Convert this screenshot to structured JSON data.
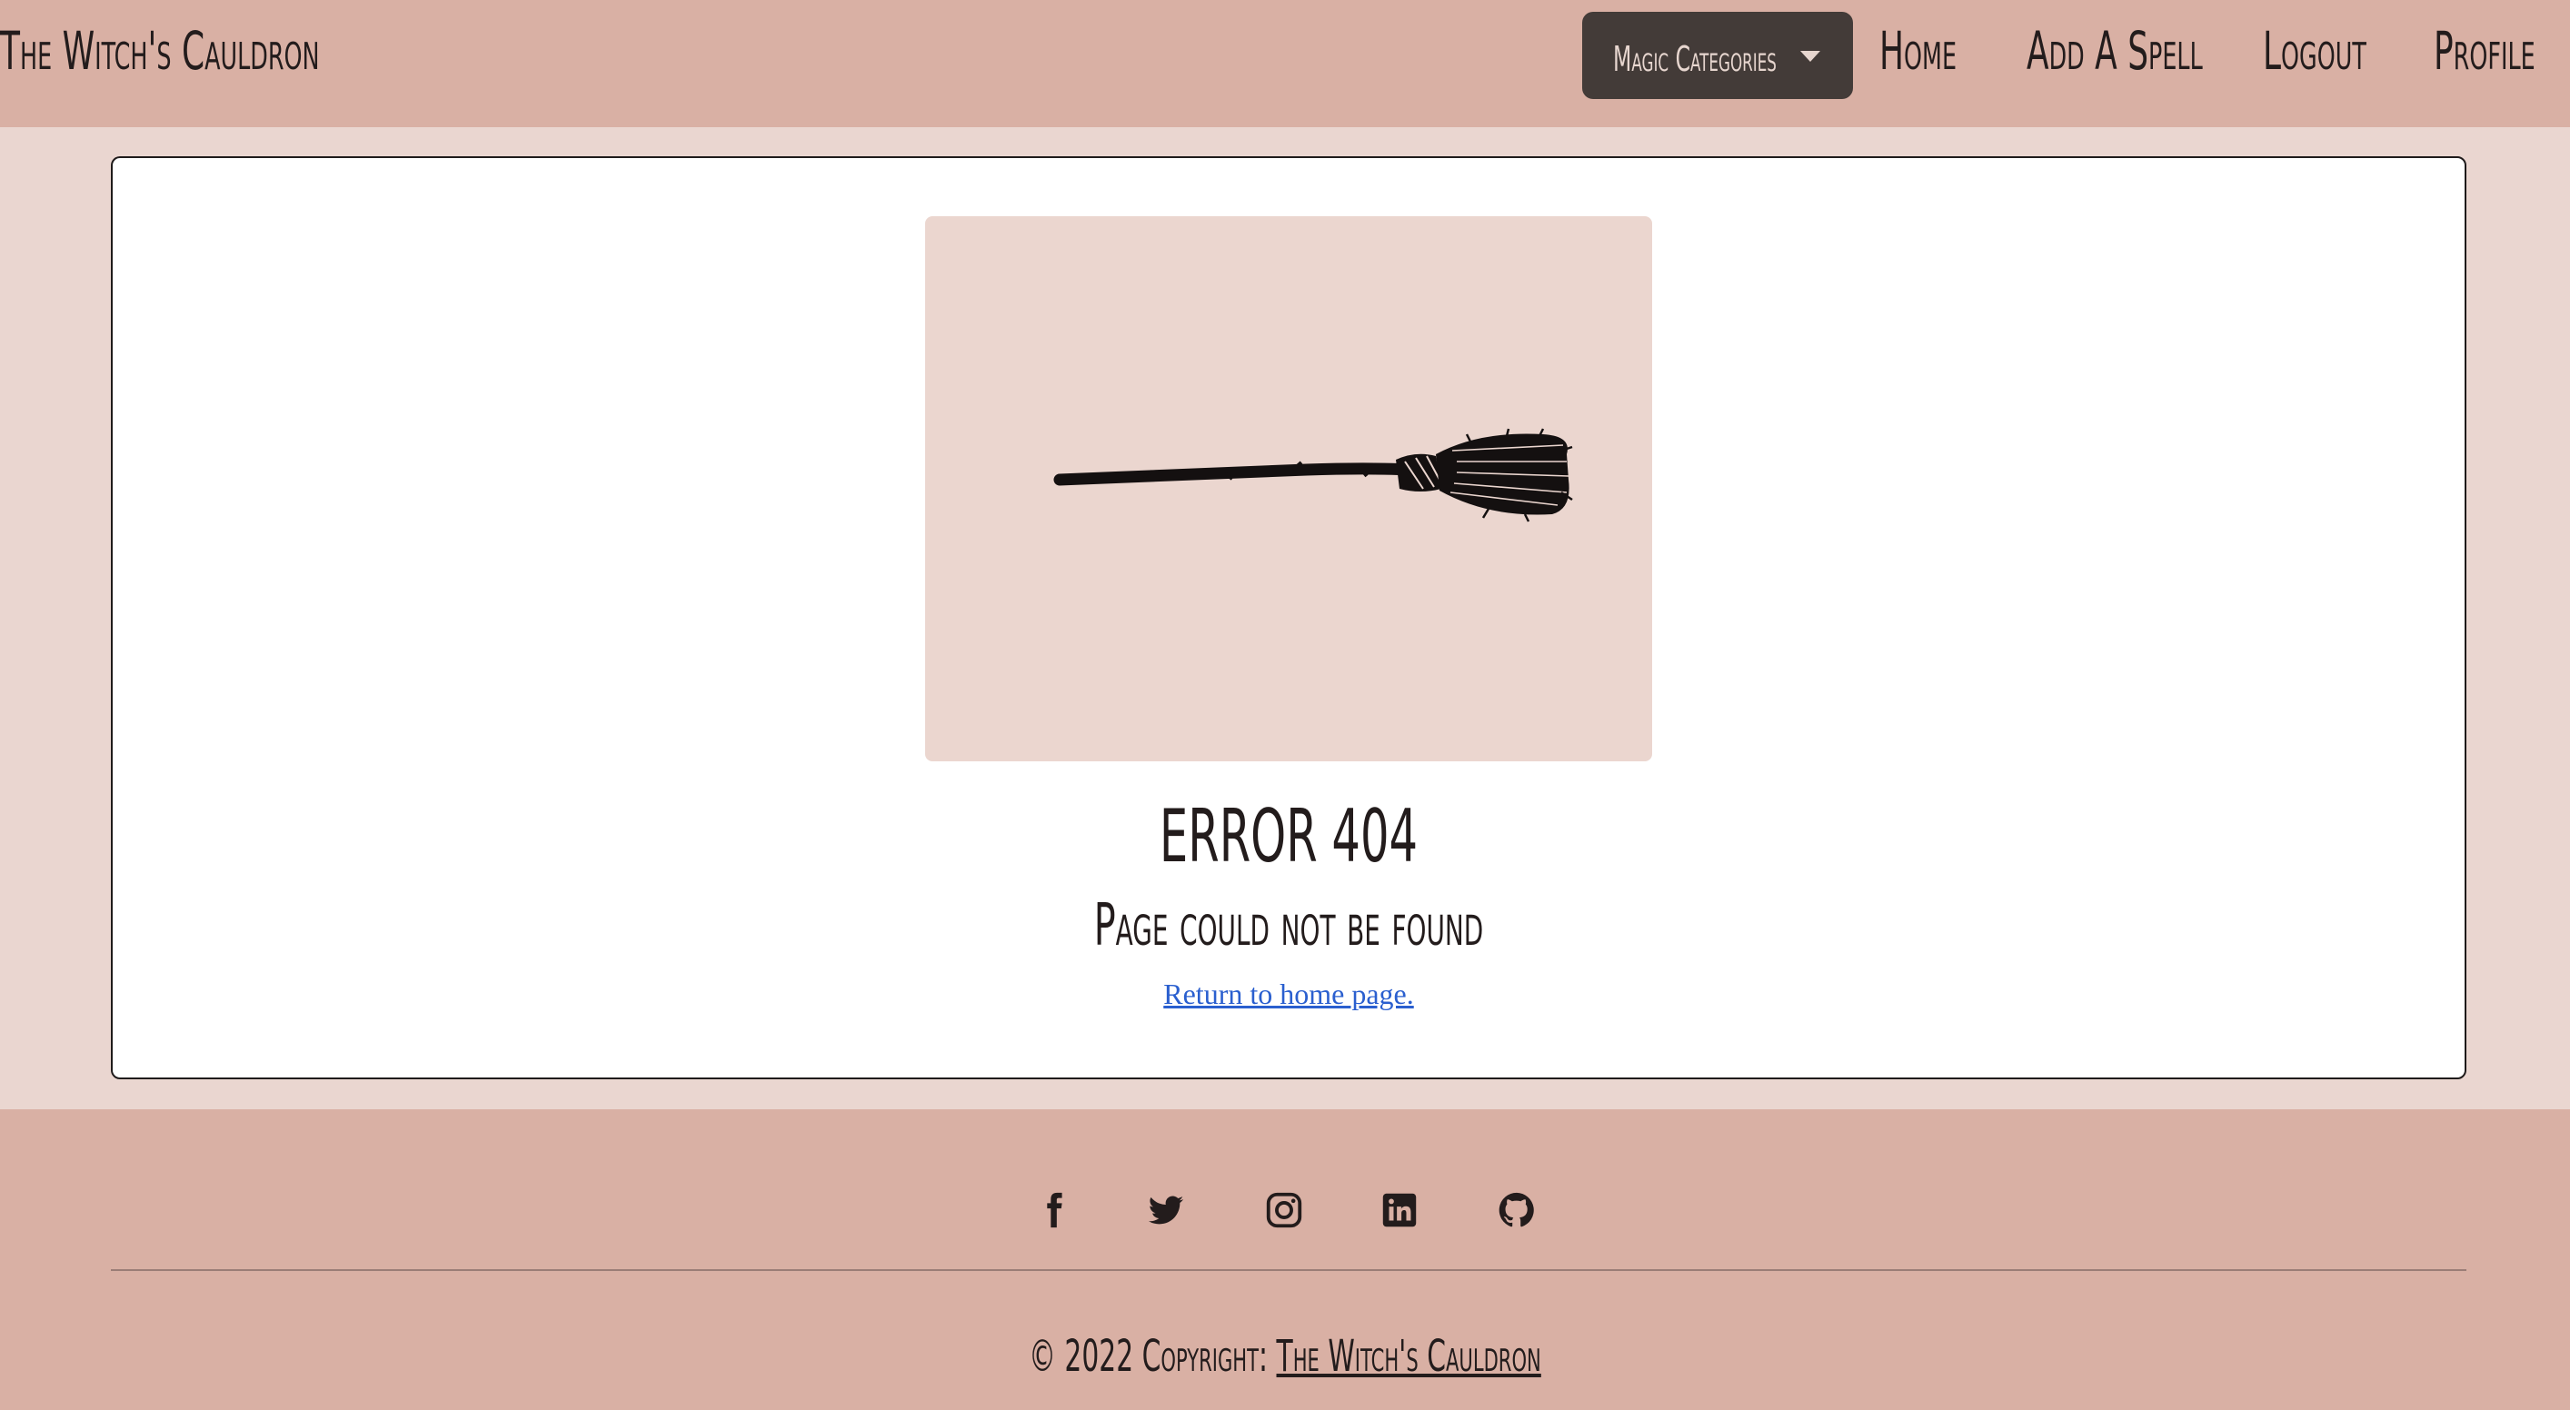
{
  "header": {
    "brand": "The Witch's Cauldron",
    "dropdown_label": "Magic Categories",
    "nav": {
      "home": "Home",
      "add_spell": "Add A Spell",
      "logout": "Logout",
      "profile": "Profile"
    }
  },
  "main": {
    "image_icon": "broom-icon",
    "error_title": "ERROR 404",
    "error_subtitle": "Page could not be found",
    "home_link": "Return to home page."
  },
  "footer": {
    "social_icons": [
      "facebook-icon",
      "twitter-icon",
      "instagram-icon",
      "linkedin-icon",
      "github-icon"
    ],
    "copyright_prefix": "© 2022 Copyright:",
    "copyright_link": "The Witch's Cauldron"
  },
  "colors": {
    "header_bg": "#d9b0a4",
    "page_bg": "#ead6d0",
    "dropdown_bg": "#433b38",
    "link_blue": "#2a5fcf"
  }
}
